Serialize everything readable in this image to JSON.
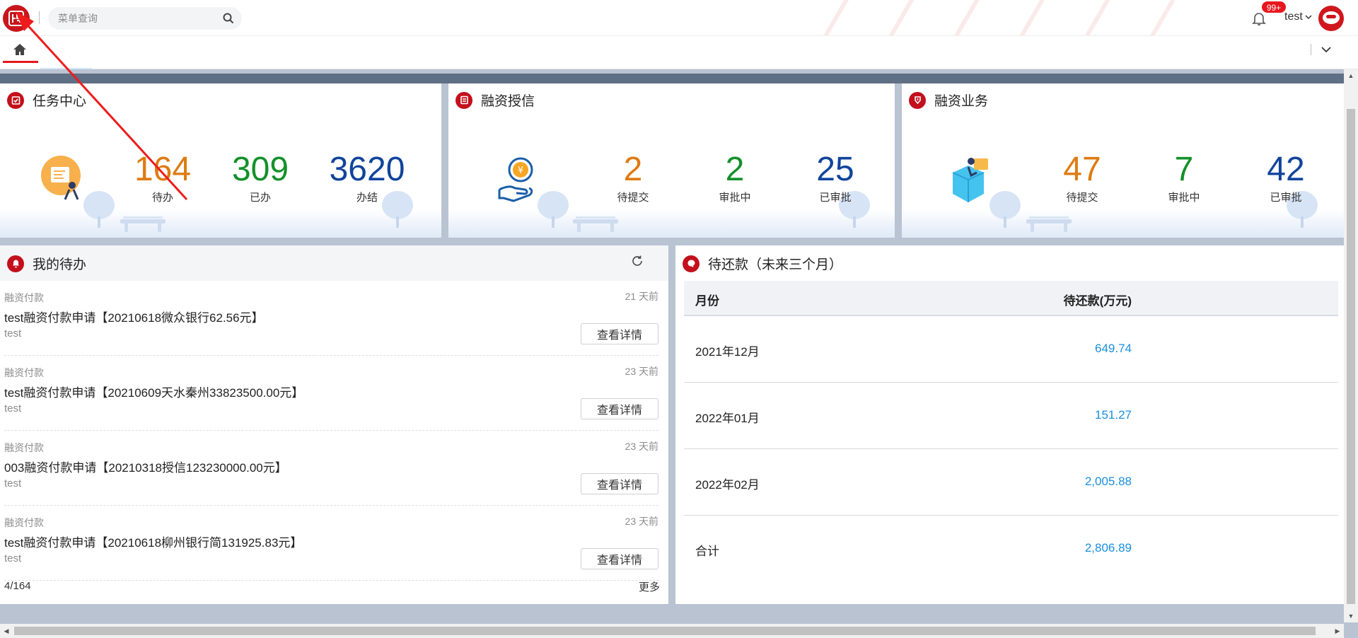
{
  "header": {
    "search_placeholder": "菜单查询",
    "notification_badge": "99+",
    "username": "test"
  },
  "tabs": {
    "home_icon": "home-icon"
  },
  "cards": [
    {
      "title": "任务中心",
      "stats": [
        {
          "value": "164",
          "label": "待办",
          "color": "#de7b12"
        },
        {
          "value": "309",
          "label": "已办",
          "color": "#14902a"
        },
        {
          "value": "3620",
          "label": "办结",
          "color": "#11449b"
        }
      ]
    },
    {
      "title": "融资授信",
      "stats": [
        {
          "value": "2",
          "label": "待提交",
          "color": "#de7b12"
        },
        {
          "value": "2",
          "label": "审批中",
          "color": "#14902a"
        },
        {
          "value": "25",
          "label": "已审批",
          "color": "#11449b"
        }
      ]
    },
    {
      "title": "融资业务",
      "stats": [
        {
          "value": "47",
          "label": "待提交",
          "color": "#de7b12"
        },
        {
          "value": "7",
          "label": "审批中",
          "color": "#14902a"
        },
        {
          "value": "42",
          "label": "已审批",
          "color": "#11449b"
        }
      ]
    }
  ],
  "todo": {
    "title": "我的待办",
    "items": [
      {
        "category": "融资付款",
        "time": "21 天前",
        "title": "test融资付款申请【20210618微众银行62.56元】",
        "user": "test",
        "button": "查看详情"
      },
      {
        "category": "融资付款",
        "time": "23 天前",
        "title": "test融资付款申请【20210609天水秦州33823500.00元】",
        "user": "test",
        "button": "查看详情"
      },
      {
        "category": "融资付款",
        "time": "23 天前",
        "title": "003融资付款申请【20210318授信123230000.00元】",
        "user": "test",
        "button": "查看详情"
      },
      {
        "category": "融资付款",
        "time": "23 天前",
        "title": "test融资付款申请【20210618柳州银行简131925.83元】",
        "user": "test",
        "button": "查看详情"
      }
    ],
    "count": "4/164",
    "more": "更多"
  },
  "repayment": {
    "title": "待还款（未来三个月）",
    "col_month": "月份",
    "col_amount": "待还款(万元)",
    "rows": [
      {
        "month": "2021年12月",
        "amount": "649.74"
      },
      {
        "month": "2022年01月",
        "amount": "151.27"
      },
      {
        "month": "2022年02月",
        "amount": "2,005.88"
      }
    ],
    "total_label": "合计",
    "total_amount": "2,806.89"
  },
  "colors": {
    "brand_red": "#c3101c",
    "amount_blue": "#1a8fdd"
  }
}
